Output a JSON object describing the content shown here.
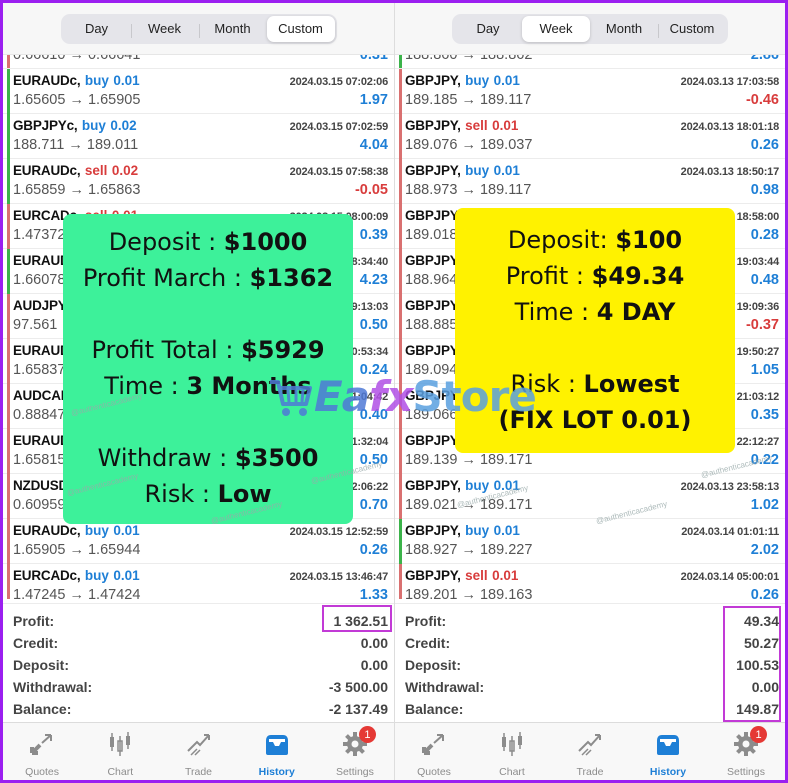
{
  "colors": {
    "buy": "#1e7fd6",
    "sell": "#d83c3c",
    "edge_profit": "#3bb34a",
    "edge_loss": "#d97070",
    "highlight_box": "#c23ad6",
    "green_overlay": "#3df19a",
    "yellow_overlay": "#fff200",
    "frame": "#9b1ff0"
  },
  "left": {
    "segments": [
      "Day",
      "Week",
      "Month",
      "Custom"
    ],
    "active_segment": "Custom",
    "partial_top_row": {
      "prices": "0.66610 → 0.66641",
      "pl": "0.31"
    },
    "trades": [
      {
        "symbol": "EURAUDc,",
        "side": "buy",
        "lot": "0.01",
        "time": "2024.03.15 07:02:06",
        "prices": "1.65605 → 1.65905",
        "pl": "1.97"
      },
      {
        "symbol": "GBPJPYc,",
        "side": "buy",
        "lot": "0.02",
        "time": "2024.03.15 07:02:59",
        "prices": "188.711 → 189.011",
        "pl": "4.04"
      },
      {
        "symbol": "EURAUDc,",
        "side": "sell",
        "lot": "0.02",
        "time": "2024.03.15 07:58:38",
        "prices": "1.65859 → 1.65863",
        "pl": "-0.05"
      },
      {
        "symbol": "EURCADc,",
        "side": "sell",
        "lot": "0.01",
        "time": "2024.03.15 08:00:09",
        "prices": "1.47372",
        "pl": "0.39"
      },
      {
        "symbol": "EURAUDc,",
        "side": "",
        "lot": "",
        "time": "8:34:40",
        "prices": "1.66078",
        "pl": "4.23"
      },
      {
        "symbol": "AUDJPYc,",
        "side": "",
        "lot": "",
        "time": "9:13:03",
        "prices": "97.561",
        "pl": "0.50"
      },
      {
        "symbol": "EURAUDc,",
        "side": "",
        "lot": "",
        "time": "0:53:34",
        "prices": "1.65837",
        "pl": "0.24"
      },
      {
        "symbol": "AUDCADc,",
        "side": "",
        "lot": "",
        "time": "1:04:42",
        "prices": "0.88847",
        "pl": "0.40"
      },
      {
        "symbol": "EURAUDc,",
        "side": "",
        "lot": "",
        "time": "1:32:04",
        "prices": "1.65815",
        "pl": "0.50"
      },
      {
        "symbol": "NZDUSDc,",
        "side": "",
        "lot": "",
        "time": "2:06:22",
        "prices": "0.60959",
        "pl": "0.70"
      },
      {
        "symbol": "EURAUDc,",
        "side": "buy",
        "lot": "0.01",
        "time": "2024.03.15 12:52:59",
        "prices": "1.65905 → 1.65944",
        "pl": "0.26"
      },
      {
        "symbol": "EURCADc,",
        "side": "buy",
        "lot": "0.01",
        "time": "2024.03.15 13:46:47",
        "prices": "1.47245 → 1.47424",
        "pl": "1.33"
      }
    ],
    "summary": [
      {
        "label": "Profit:",
        "value": "1 362.51"
      },
      {
        "label": "Credit:",
        "value": "0.00"
      },
      {
        "label": "Deposit:",
        "value": "0.00"
      },
      {
        "label": "Withdrawal:",
        "value": "-3 500.00"
      },
      {
        "label": "Balance:",
        "value": "-2 137.49"
      }
    ],
    "overlay": {
      "lines": [
        {
          "label": "Deposit : ",
          "value": "$1000"
        },
        {
          "label": "Profit March : ",
          "value": "$1362"
        },
        null,
        {
          "label": "Profit Total : ",
          "value": "$5929"
        },
        {
          "label": "Time : ",
          "value": "3 Months"
        },
        null,
        {
          "label": "Withdraw : ",
          "value": "$3500"
        },
        {
          "label": "Risk : ",
          "value": "Low"
        }
      ]
    }
  },
  "right": {
    "segments": [
      "Day",
      "Week",
      "Month",
      "Custom"
    ],
    "active_segment": "Week",
    "partial_top_row": {
      "prices": "188.860 → 188.862",
      "pl": "2.86"
    },
    "trades": [
      {
        "symbol": "GBPJPY,",
        "side": "buy",
        "lot": "0.01",
        "time": "2024.03.13 17:03:58",
        "prices": "189.185 → 189.117",
        "pl": "-0.46"
      },
      {
        "symbol": "GBPJPY,",
        "side": "sell",
        "lot": "0.01",
        "time": "2024.03.13 18:01:18",
        "prices": "189.076 → 189.037",
        "pl": "0.26"
      },
      {
        "symbol": "GBPJPY,",
        "side": "buy",
        "lot": "0.01",
        "time": "2024.03.13 18:50:17",
        "prices": "188.973 → 189.117",
        "pl": "0.98"
      },
      {
        "symbol": "GBPJPY,",
        "side": "sell",
        "lot": "0.01",
        "time": "18:58:00",
        "prices": "189.018",
        "pl": "0.28"
      },
      {
        "symbol": "GBPJPY,",
        "side": "",
        "lot": "",
        "time": "19:03:44",
        "prices": "188.964",
        "pl": "0.48"
      },
      {
        "symbol": "GBPJPY,",
        "side": "",
        "lot": "",
        "time": "19:09:36",
        "prices": "188.885",
        "pl": "-0.37"
      },
      {
        "symbol": "GBPJPY,",
        "side": "",
        "lot": "",
        "time": "19:50:27",
        "prices": "189.094",
        "pl": "1.05"
      },
      {
        "symbol": "GBPJPY,",
        "side": "",
        "lot": "",
        "time": "21:03:12",
        "prices": "189.066",
        "pl": "0.35"
      },
      {
        "symbol": "GBPJPY,",
        "side": "",
        "lot": "",
        "time": "22:12:27",
        "prices": "189.139 → 189.171",
        "pl": "0.22"
      },
      {
        "symbol": "GBPJPY,",
        "side": "buy",
        "lot": "0.01",
        "time": "2024.03.13 23:58:13",
        "prices": "189.021 → 189.171",
        "pl": "1.02"
      },
      {
        "symbol": "GBPJPY,",
        "side": "buy",
        "lot": "0.01",
        "time": "2024.03.14 01:01:11",
        "prices": "188.927 → 189.227",
        "pl": "2.02"
      },
      {
        "symbol": "GBPJPY,",
        "side": "sell",
        "lot": "0.01",
        "time": "2024.03.14 05:00:01",
        "prices": "189.201 → 189.163",
        "pl": "0.26"
      }
    ],
    "summary": [
      {
        "label": "Profit:",
        "value": "49.34"
      },
      {
        "label": "Credit:",
        "value": "50.27"
      },
      {
        "label": "Deposit:",
        "value": "100.53"
      },
      {
        "label": "Withdrawal:",
        "value": "0.00"
      },
      {
        "label": "Balance:",
        "value": "149.87"
      }
    ],
    "overlay": {
      "lines": [
        {
          "label": "Deposit: ",
          "value": "$100"
        },
        {
          "label": "Profit : ",
          "value": "$49.34"
        },
        {
          "label": "Time : ",
          "value": "4 DAY"
        },
        null,
        {
          "label": "Risk : ",
          "value": "Lowest"
        },
        {
          "label": "",
          "value": "(FIX LOT 0.01)"
        }
      ]
    }
  },
  "tabbar": {
    "tabs": [
      {
        "label": "Quotes",
        "icon": "quotes-arrows-icon"
      },
      {
        "label": "Chart",
        "icon": "candlestick-icon"
      },
      {
        "label": "Trade",
        "icon": "trade-trend-icon"
      },
      {
        "label": "History",
        "icon": "inbox-tray-icon",
        "active": true
      },
      {
        "label": "Settings",
        "icon": "gear-icon",
        "badge": "1"
      }
    ]
  },
  "watermark": {
    "brand_part1": "Ea",
    "brand_part2": "fx",
    "brand_part3": "Store",
    "handle": "@authenticacademy"
  }
}
